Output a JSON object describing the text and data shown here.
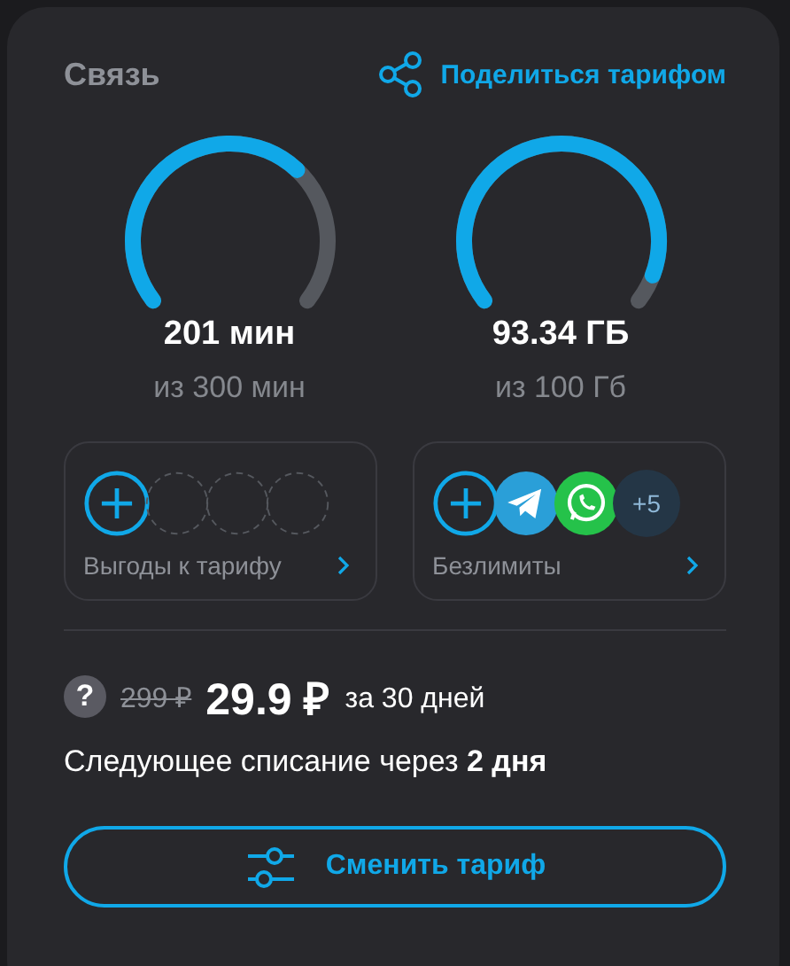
{
  "header": {
    "title": "Связь",
    "share_link": "Поделиться тарифом"
  },
  "meters": [
    {
      "value": "201 мин",
      "limit": "из 300 мин"
    },
    {
      "value": "93.34 ГБ",
      "limit": "из 100 Гб"
    }
  ],
  "tiles": [
    {
      "label": "Выгоды к тарифу",
      "icons": [
        {
          "kind": "add"
        },
        {
          "kind": "empty"
        },
        {
          "kind": "empty"
        },
        {
          "kind": "empty"
        }
      ]
    },
    {
      "label": "Безлимиты",
      "icons": [
        {
          "kind": "add"
        },
        {
          "kind": "plane"
        },
        {
          "kind": "phone"
        },
        {
          "kind": "count",
          "text": "+5"
        }
      ]
    }
  ],
  "price": {
    "help": "?",
    "old": "299 ₽",
    "current": "29.9 ₽",
    "period": "за 30 дней"
  },
  "next_charge": "Следующее списание через **2 дня**",
  "button": "Сменить тариф"
}
